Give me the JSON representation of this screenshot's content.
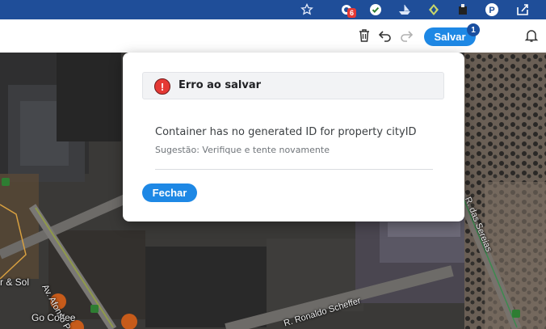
{
  "toolbar": {
    "save_label": "Salvar",
    "save_badge": "1"
  },
  "browser": {
    "extension_badge": "6"
  },
  "dialog": {
    "title": "Erro ao salvar",
    "message": "Container has no generated ID for property cityID",
    "suggestion": "Sugestão: Verifique e tente novamente",
    "close_label": "Fechar",
    "error_icon_glyph": "!"
  },
  "map": {
    "labels": {
      "place_1": "r & Sol",
      "place_2": "Go Coffee",
      "street_1": "Av. Afonso Pena",
      "street_2": "R. das Sereias",
      "street_3": "R. Ronaldo Scheffer"
    }
  },
  "colors": {
    "accent": "#1e88e5",
    "error": "#e53935",
    "browser_bar": "#1f4e99"
  },
  "icons": [
    "star-icon",
    "extension-icon",
    "check-extension-icon",
    "boat-extension-icon",
    "diamond-extension-icon",
    "puzzle-extension-icon",
    "p-extension-icon",
    "share-icon",
    "trash-icon",
    "undo-icon",
    "redo-icon",
    "bell-icon",
    "error-icon"
  ]
}
